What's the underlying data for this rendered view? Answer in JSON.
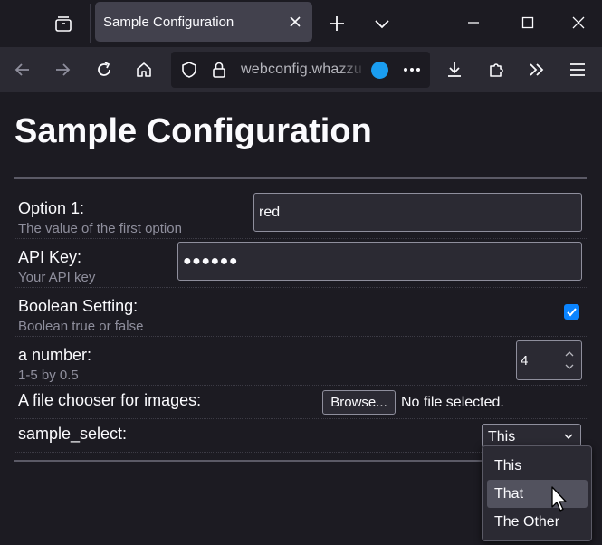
{
  "browser": {
    "tab_title": "Sample Configuration",
    "url": "webconfig.whazzup"
  },
  "page": {
    "title": "Sample Configuration"
  },
  "settings": [
    {
      "label": "Option 1:",
      "description": "The value of the first option",
      "value": "red"
    },
    {
      "label": "API Key:",
      "description": "Your API key",
      "value": "●●●●●●"
    },
    {
      "label": "Boolean Setting:",
      "description": "Boolean true or false",
      "checked": true
    },
    {
      "label": "a number:",
      "description": "1-5 by 0.5",
      "value": "4"
    },
    {
      "label": "A file chooser for images:",
      "button": "Browse...",
      "status": "No file selected."
    },
    {
      "label": "sample_select:",
      "value": "This",
      "options": [
        "This",
        "That",
        "The Other"
      ],
      "highlighted": "That"
    }
  ],
  "colors": {
    "accent": "#0a84ff",
    "page_bg": "#1c1b22",
    "toolbar_bg": "#2b2a33",
    "tab_bg": "#42414d"
  },
  "icons": [
    "tab-list-icon",
    "close-icon",
    "plus-icon",
    "chevron-down-icon",
    "minimize-icon",
    "maximize-icon",
    "window-close-icon",
    "back-icon",
    "forward-icon",
    "reload-icon",
    "home-icon",
    "shield-icon",
    "lock-icon",
    "more-icon",
    "download-icon",
    "extensions-icon",
    "overflow-icon",
    "menu-icon",
    "checkmark-icon",
    "spinner-icon",
    "mouse-cursor-icon"
  ]
}
